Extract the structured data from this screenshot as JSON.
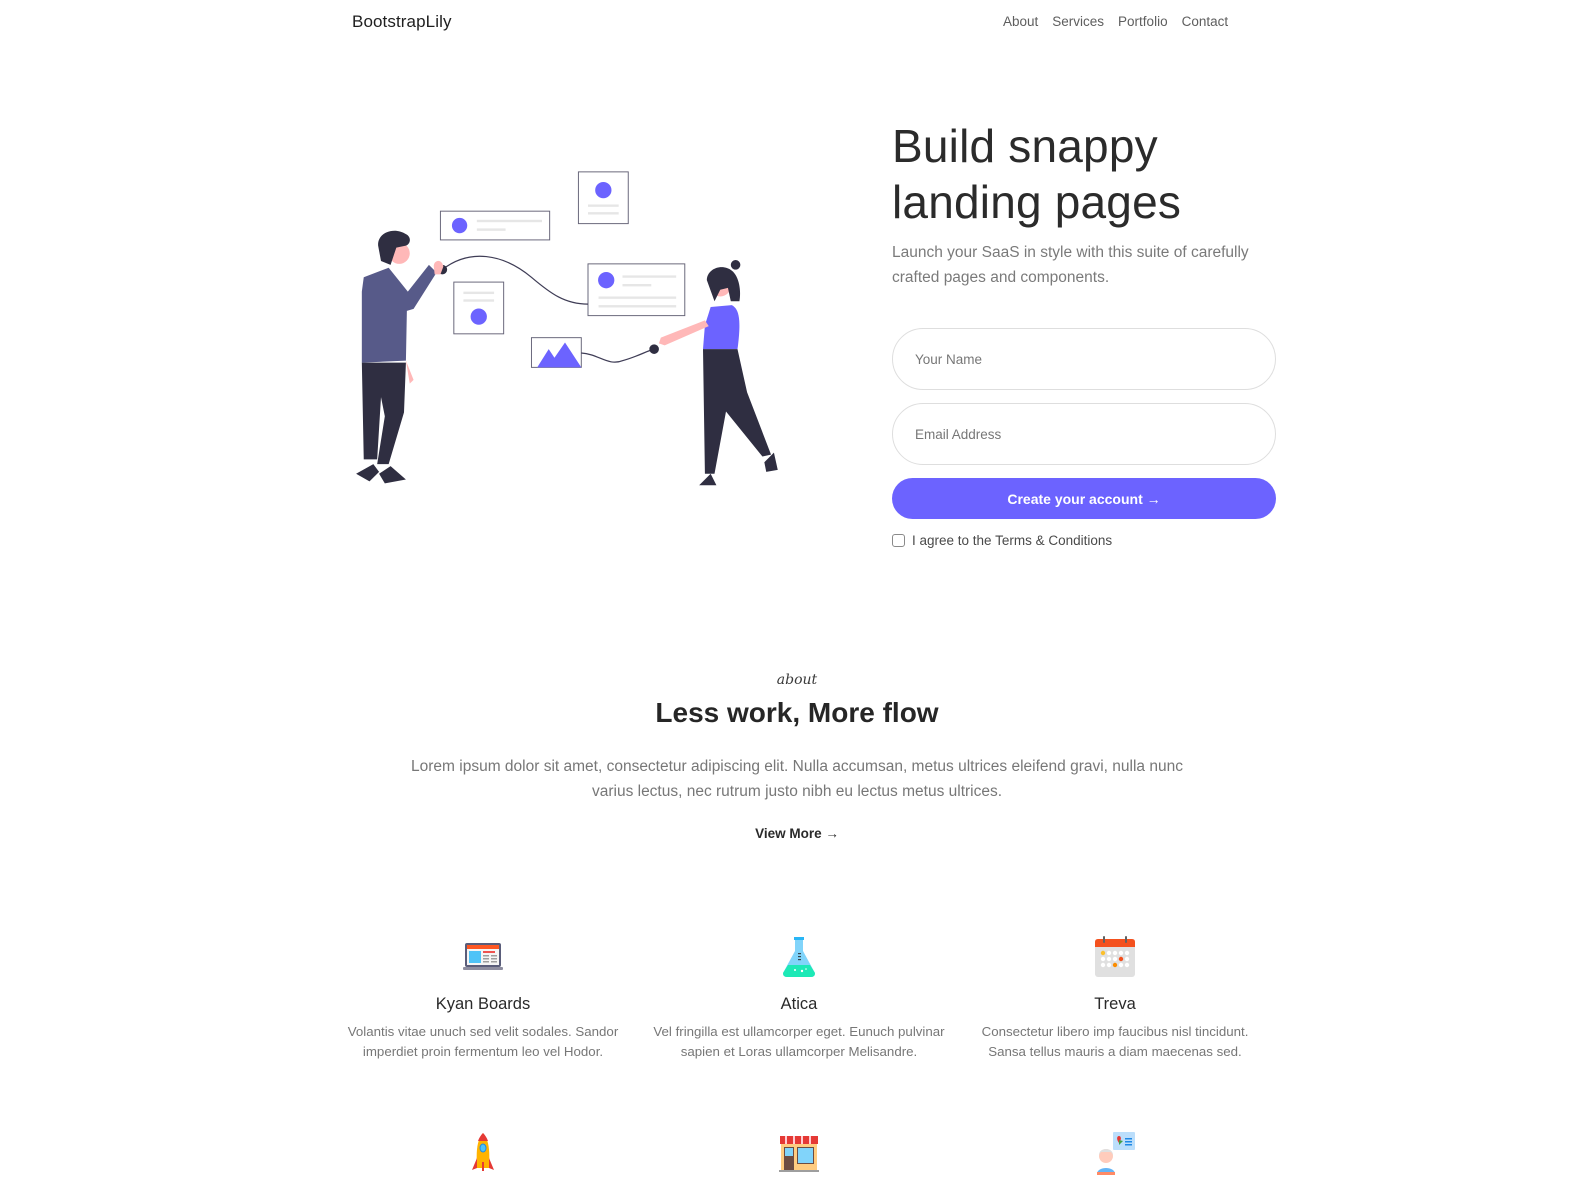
{
  "nav": {
    "brand": "BootstrapLily",
    "links": [
      "About",
      "Services",
      "Portfolio",
      "Contact"
    ]
  },
  "hero": {
    "title_line1": "Build snappy",
    "title_line2": "landing pages",
    "subtitle": "Launch your SaaS in style with this suite of carefully crafted pages and components.",
    "illustration": "people-connecting-content-cards-illustration"
  },
  "form": {
    "name_placeholder": "Your Name",
    "name_value": "",
    "email_placeholder": "Email Address",
    "email_value": "",
    "submit_label": "Create your account →",
    "agree_label": "I agree to the Terms & Conditions",
    "agree_checked": false
  },
  "about": {
    "kicker": "about",
    "title": "Less work, More flow",
    "body": "Lorem ipsum dolor sit amet, consectetur adipiscing elit. Nulla accumsan, metus ultrices eleifend gravi, nulla nunc varius lectus, nec rutrum justo nibh eu lectus metus ultrices.",
    "view_more": "View More →"
  },
  "features": [
    {
      "icon": "laptop-dashboard-icon",
      "title": "Kyan Boards",
      "desc": "Volantis vitae unuch sed velit sodales. Sandor imperdiet proin fermentum leo vel Hodor."
    },
    {
      "icon": "flask-icon",
      "title": "Atica",
      "desc": "Vel fringilla est ullamcorper eget. Eunuch pulvinar sapien et Loras ullamcorper Melisandre."
    },
    {
      "icon": "calendar-icon",
      "title": "Treva",
      "desc": "Consectetur libero imp faucibus nisl tincidunt. Sansa tellus mauris a diam maecenas sed."
    },
    {
      "icon": "rocket-icon",
      "title": "",
      "desc": ""
    },
    {
      "icon": "storefront-icon",
      "title": "",
      "desc": ""
    },
    {
      "icon": "person-chat-icon",
      "title": "",
      "desc": ""
    }
  ],
  "colors": {
    "accent": "#6c63ff",
    "figure_dark": "#2f2e41",
    "shirt": "#575a89",
    "skin": "#ffb8b8"
  }
}
